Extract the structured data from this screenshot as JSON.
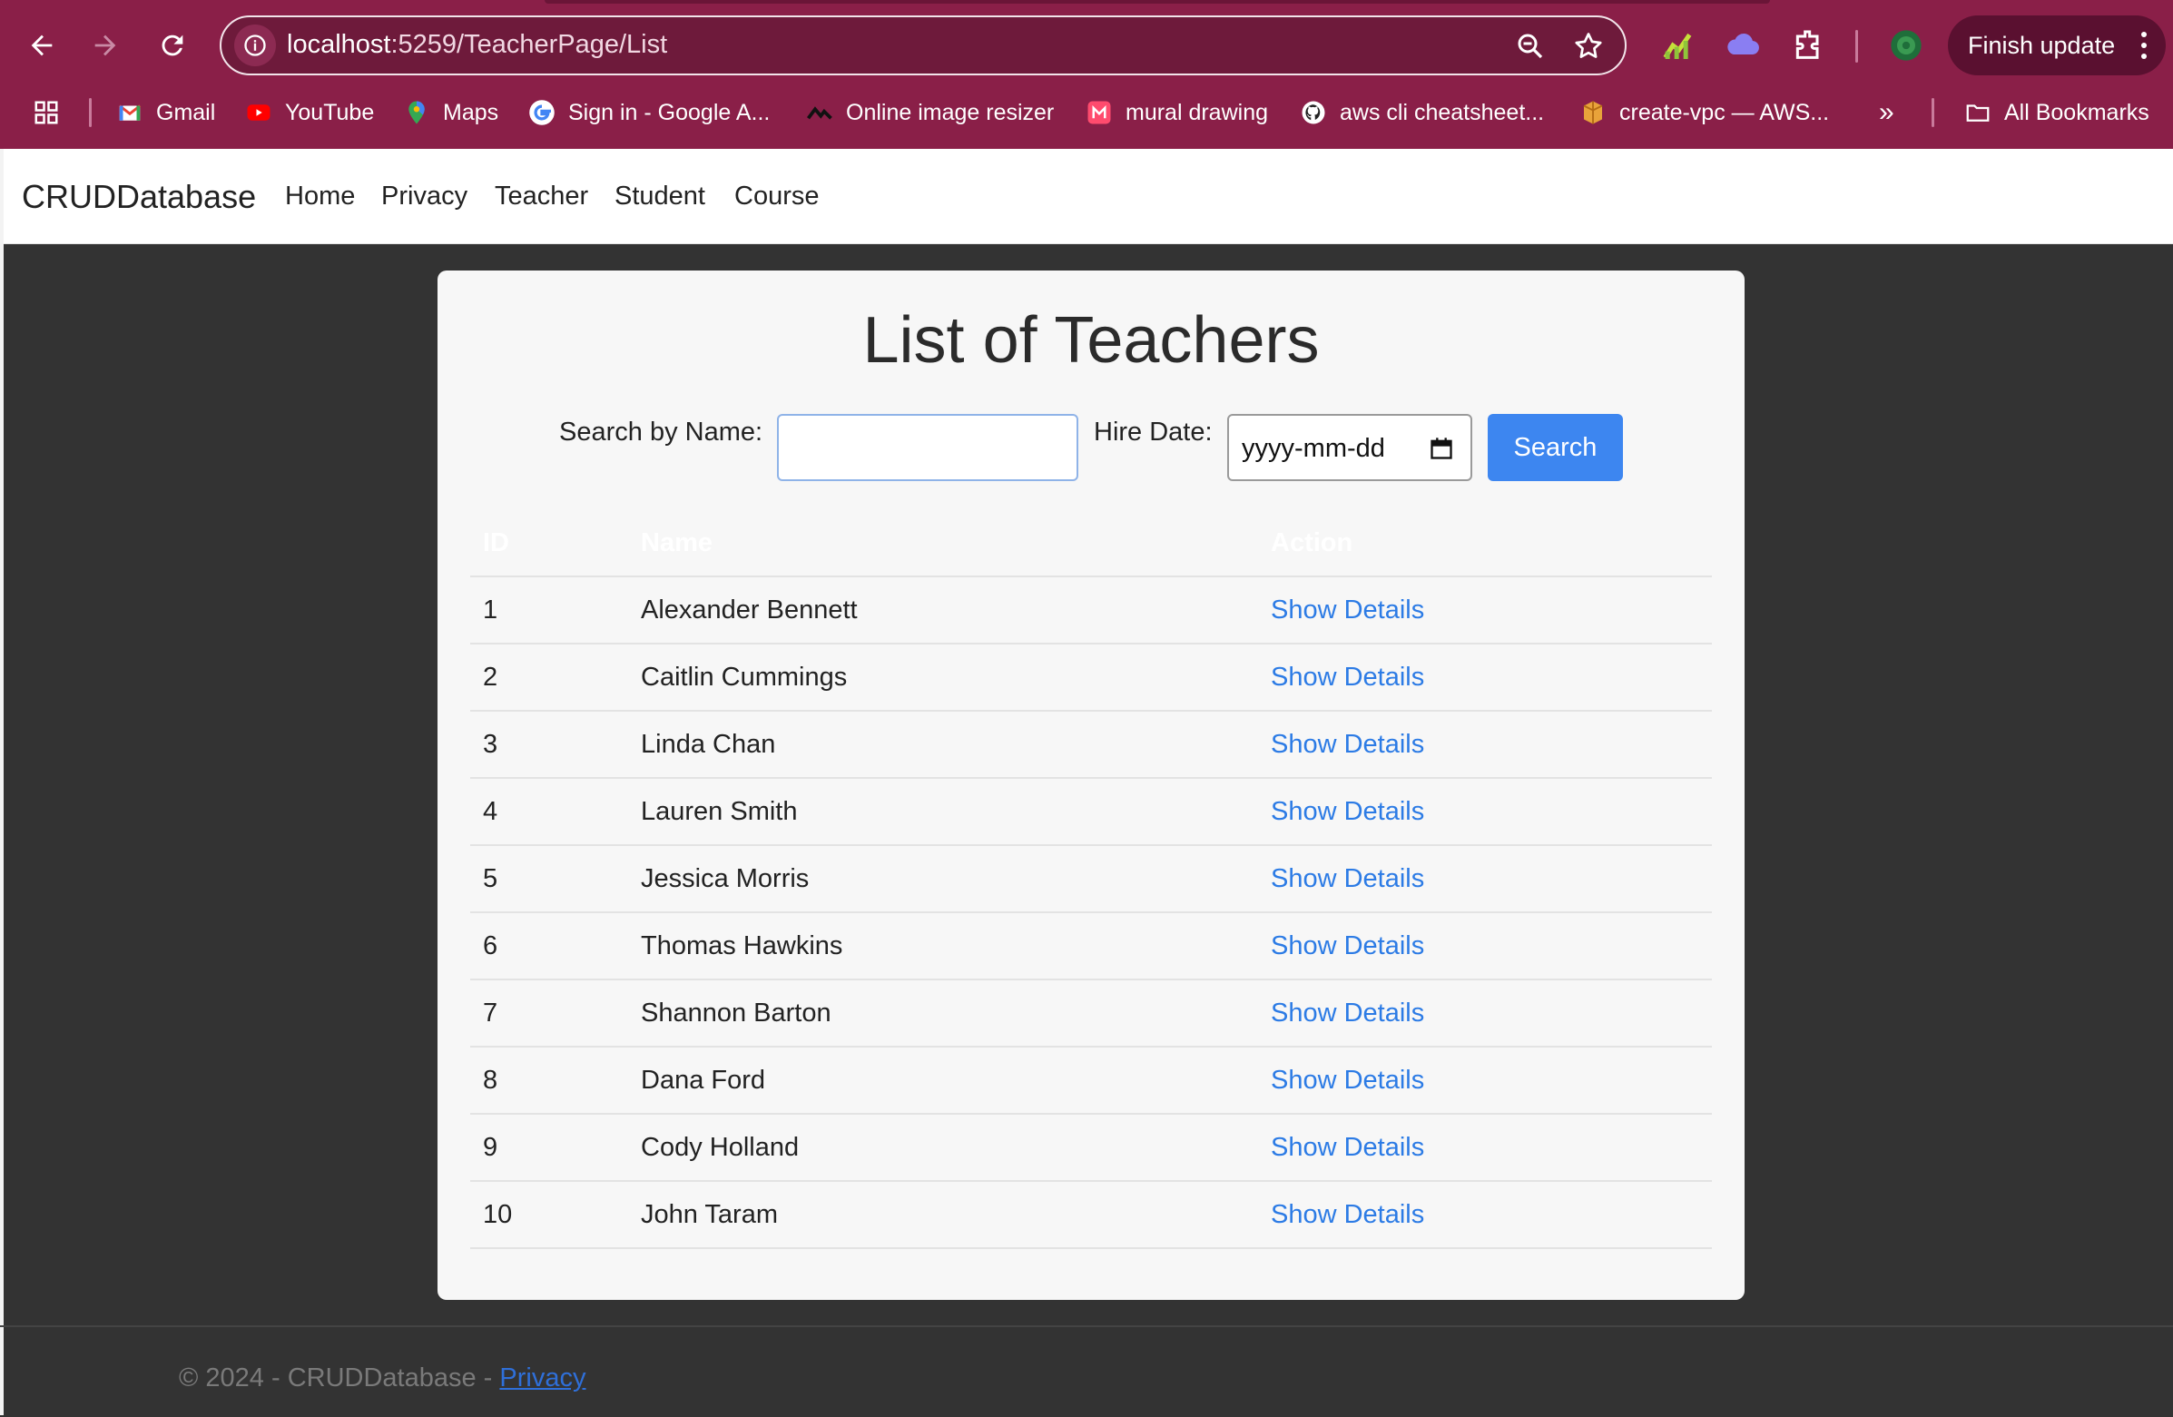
{
  "browser": {
    "url_host": "localhost",
    "url_path": ":5259/TeacherPage/List",
    "finish_update_label": "Finish update",
    "bookmarks": [
      {
        "label": "Gmail",
        "icon": "gmail-icon"
      },
      {
        "label": "YouTube",
        "icon": "youtube-icon"
      },
      {
        "label": "Maps",
        "icon": "maps-icon"
      },
      {
        "label": "Sign in - Google A...",
        "icon": "google-icon"
      },
      {
        "label": "Online image resizer",
        "icon": "resizer-icon"
      },
      {
        "label": "mural drawing",
        "icon": "mural-icon"
      },
      {
        "label": "aws cli cheatsheet...",
        "icon": "github-icon"
      },
      {
        "label": "create-vpc — AWS...",
        "icon": "aws-icon"
      }
    ],
    "overflow_label": "»",
    "all_bookmarks_label": "All Bookmarks"
  },
  "navbar": {
    "brand": "CRUDDatabase",
    "links": [
      "Home",
      "Privacy",
      "Teacher",
      "Student",
      "Course"
    ]
  },
  "page": {
    "title": "List of Teachers",
    "search_name_label": "Search by Name:",
    "search_name_value": "",
    "hire_date_label": "Hire Date:",
    "hire_date_placeholder": "yyyy-mm-dd",
    "search_button": "Search"
  },
  "table": {
    "headers": [
      "ID",
      "Name",
      "Action"
    ],
    "rows": [
      {
        "id": "1",
        "name": "Alexander Bennett",
        "action": "Show Details"
      },
      {
        "id": "2",
        "name": "Caitlin Cummings",
        "action": "Show Details"
      },
      {
        "id": "3",
        "name": "Linda Chan",
        "action": "Show Details"
      },
      {
        "id": "4",
        "name": "Lauren Smith",
        "action": "Show Details"
      },
      {
        "id": "5",
        "name": "Jessica Morris",
        "action": "Show Details"
      },
      {
        "id": "6",
        "name": "Thomas Hawkins",
        "action": "Show Details"
      },
      {
        "id": "7",
        "name": "Shannon Barton",
        "action": "Show Details"
      },
      {
        "id": "8",
        "name": "Dana Ford",
        "action": "Show Details"
      },
      {
        "id": "9",
        "name": "Cody Holland",
        "action": "Show Details"
      },
      {
        "id": "10",
        "name": "John Taram",
        "action": "Show Details"
      }
    ]
  },
  "footer": {
    "text": "© 2024 - CRUDDatabase - ",
    "privacy_link": "Privacy"
  },
  "colors": {
    "chrome": "#8a1f48",
    "page_bg": "#333333",
    "card_bg": "#f7f7f7",
    "accent": "#3d86f0",
    "link": "#2c7be5"
  }
}
